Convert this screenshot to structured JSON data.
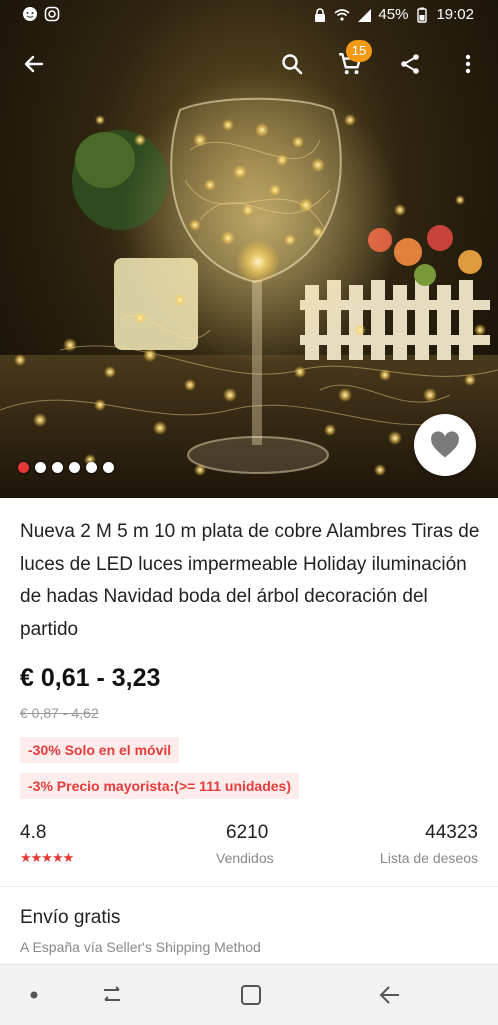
{
  "status_bar": {
    "battery": "45%",
    "time": "19:02"
  },
  "toolbar": {
    "cart_count": "15"
  },
  "gallery": {
    "image_count": 6,
    "active_index": 0
  },
  "product": {
    "title": "Nueva 2 M 5 m 10 m plata de cobre Alambres Tiras de luces de LED luces impermeable Holiday iluminación de hadas Navidad boda del árbol decoración del partido",
    "price": "€ 0,61 - 3,23",
    "old_price": "€ 0,87 - 4,62",
    "promo_mobile": "-30% Solo en el móvil",
    "promo_wholesale": "-3% Precio mayorista:(>= 111 unidades)"
  },
  "stats": {
    "rating": "4.8",
    "rating_stars": "★★★★★",
    "sold_count": "6210",
    "sold_label": "Vendidos",
    "wishlist_count": "44323",
    "wishlist_label": "Lista de deseos"
  },
  "shipping": {
    "title": "Envío gratis",
    "subtitle": "A España vía Seller's Shipping Method"
  },
  "colors": {
    "accent_red": "#e53935",
    "promo_bg": "#fdecec",
    "badge_orange": "#f39a15"
  },
  "icons": {
    "back": "arrow-left-icon",
    "search": "search-icon",
    "cart": "cart-icon",
    "share": "share-icon",
    "more": "more-vert-icon",
    "wishlist": "heart-icon"
  }
}
